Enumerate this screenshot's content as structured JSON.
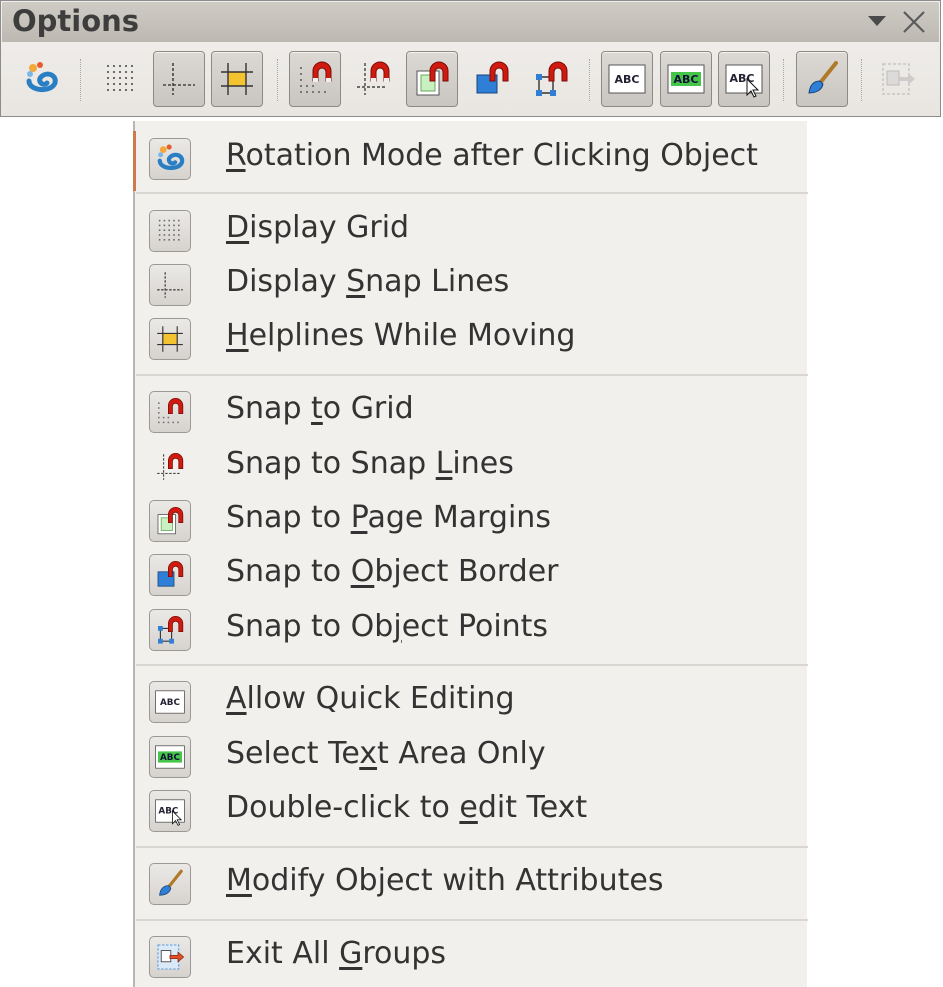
{
  "toolbar": {
    "title": "Options",
    "controls": {
      "dropdown_icon": "triangle-down-icon",
      "close_icon": "close-x-icon"
    },
    "buttons": [
      {
        "name": "rotation-mode",
        "icon": "rotation-mode-icon",
        "active": false
      },
      {
        "name": "display-grid",
        "icon": "display-grid-icon",
        "active": false
      },
      {
        "name": "display-snap-lines",
        "icon": "snap-lines-icon",
        "active": true
      },
      {
        "name": "helplines-while-moving",
        "icon": "helplines-icon",
        "active": true
      },
      {
        "name": "snap-to-grid",
        "icon": "snap-grid-magnet-icon",
        "active": true
      },
      {
        "name": "snap-to-snap-lines",
        "icon": "snap-lines-magnet-icon",
        "active": false
      },
      {
        "name": "snap-to-page-margins",
        "icon": "page-margins-magnet-icon",
        "active": true
      },
      {
        "name": "snap-to-object-border",
        "icon": "object-border-magnet-icon",
        "active": false
      },
      {
        "name": "snap-to-object-points",
        "icon": "object-points-magnet-icon",
        "active": false
      },
      {
        "name": "allow-quick-editing",
        "icon": "abc-icon",
        "active": true
      },
      {
        "name": "select-text-area-only",
        "icon": "abc-green-icon",
        "active": true
      },
      {
        "name": "double-click-edit-text",
        "icon": "abc-cursor-icon",
        "active": true
      },
      {
        "name": "modify-object-attributes",
        "icon": "paintbrush-icon",
        "active": true
      },
      {
        "name": "exit-all-groups",
        "icon": "exit-groups-icon",
        "active": false,
        "disabled": true
      }
    ]
  },
  "menu": {
    "items": [
      {
        "pre": "",
        "u": "R",
        "post": "otation Mode after Clicking Object",
        "icon": "rotation-mode-icon",
        "checked": true
      },
      {
        "pre": "",
        "u": "D",
        "post": "isplay Grid",
        "icon": "display-grid-icon",
        "checked": true
      },
      {
        "pre": "Display ",
        "u": "S",
        "post": "nap Lines",
        "icon": "snap-lines-icon",
        "checked": true
      },
      {
        "pre": "",
        "u": "H",
        "post": "elplines While Moving",
        "icon": "helplines-icon",
        "checked": true
      },
      {
        "pre": "Snap ",
        "u": "t",
        "post": "o Grid",
        "icon": "snap-grid-magnet-icon",
        "checked": true
      },
      {
        "pre": "Snap to Snap ",
        "u": "L",
        "post": "ines",
        "icon": "snap-lines-magnet-icon",
        "checked": false
      },
      {
        "pre": "Snap to ",
        "u": "P",
        "post": "age Margins",
        "icon": "page-margins-magnet-icon",
        "checked": true
      },
      {
        "pre": "Snap to ",
        "u": "O",
        "post": "bject Border",
        "icon": "object-border-magnet-icon",
        "checked": true
      },
      {
        "pre": "Snap to Ob",
        "u": "j",
        "post": "ect Points",
        "icon": "object-points-magnet-icon",
        "checked": true
      },
      {
        "pre": "",
        "u": "A",
        "post": "llow Quick Editing",
        "icon": "abc-icon",
        "checked": true
      },
      {
        "pre": "Select Te",
        "u": "x",
        "post": "t Area Only",
        "icon": "abc-green-icon",
        "checked": true
      },
      {
        "pre": "Double-click to ",
        "u": "e",
        "post": "dit Text",
        "icon": "abc-cursor-icon",
        "checked": true
      },
      {
        "pre": "",
        "u": "M",
        "post": "odify Object with Attributes",
        "icon": "paintbrush-icon",
        "checked": true
      },
      {
        "pre": "Exit All ",
        "u": "G",
        "post": "roups",
        "icon": "exit-groups-icon",
        "checked": true
      }
    ]
  },
  "colors": {
    "titlebar": "#c6c2bc",
    "menu_bg": "#f2f0ed",
    "text": "#333333",
    "accent": "#cf7a4d",
    "magnet_red": "#d01a10",
    "object_blue": "#2f7fd6"
  }
}
